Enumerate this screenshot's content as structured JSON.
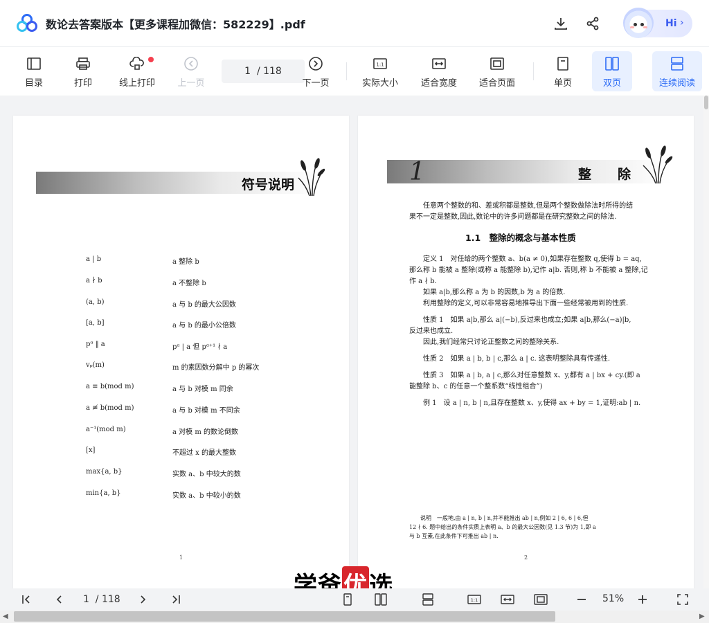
{
  "titlebar": {
    "title": "数论去答案版本【更多课程加微信：582229】.pdf",
    "hi_label": "Hi",
    "icons": [
      "download-icon",
      "share-icon"
    ]
  },
  "toolbar": {
    "items": [
      {
        "label": "目录",
        "icon": "toc-icon"
      },
      {
        "label": "打印",
        "icon": "printer-icon"
      },
      {
        "label": "线上打印",
        "icon": "cloud-print-icon"
      },
      {
        "label": "上一页",
        "icon": "prev-page-icon"
      },
      {
        "label": "下一页",
        "icon": "next-page-icon"
      },
      {
        "label": "实际大小",
        "icon": "actual-size-icon"
      },
      {
        "label": "适合宽度",
        "icon": "fit-width-icon"
      },
      {
        "label": "适合页面",
        "icon": "fit-page-icon"
      },
      {
        "label": "单页",
        "icon": "single-page-icon"
      },
      {
        "label": "双页",
        "icon": "double-page-icon"
      },
      {
        "label": "连续阅读",
        "icon": "continuous-icon"
      }
    ],
    "page_display": "1  / 118"
  },
  "page1": {
    "banner_title": "符号说明",
    "rows": [
      {
        "sym": "a | b",
        "desc": "a 整除 b"
      },
      {
        "sym": "a ∤ b",
        "desc": "a 不整除 b"
      },
      {
        "sym": "(a, b)",
        "desc": "a 与 b 的最大公因数"
      },
      {
        "sym": "[a, b]",
        "desc": "a 与 b 的最小公倍数"
      },
      {
        "sym": "pᵅ ‖ a",
        "desc": "pᵅ | a 但 pᵅ⁺¹ ∤ a"
      },
      {
        "sym": "vₚ(m)",
        "desc": "m 的素因数分解中 p 的幂次"
      },
      {
        "sym": "a ≡ b(mod m)",
        "desc": "a 与 b 对模 m 同余"
      },
      {
        "sym": "a ≢ b(mod m)",
        "desc": "a 与 b 对模 m 不同余"
      },
      {
        "sym": "a⁻¹(mod m)",
        "desc": "a 对模 m 的数论倒数"
      },
      {
        "sym": "[x]",
        "desc": "不超过 x 的最大整数"
      },
      {
        "sym": "max{a, b}",
        "desc": "实数 a、b 中较大的数"
      },
      {
        "sym": "min{a, b}",
        "desc": "实数 a、b 中较小的数"
      }
    ],
    "page_number": "1"
  },
  "page2": {
    "chapter_number": "1",
    "chapter_title": "整　　除",
    "intro": [
      "任意两个整数的和、差或积都是整数,但是两个整数做除法时所得的结",
      "果不一定是整数,因此,数论中的许多问题都是在研究整数之间的除法."
    ],
    "section_title": "1.1　整除的概念与基本性质",
    "lines": [
      {
        "text": "定义 1　对任给的两个整数 a、b(a ≠ 0),如果存在整数 q,使得 b = aq,",
        "indent": true,
        "bold_prefix": "定义 1"
      },
      {
        "text": "那么称 b 能被 a 整除(或称 a 能整除 b),记作 a|b. 否则,称 b 不能被 a 整除,记",
        "indent": false
      },
      {
        "text": "作 a ∤ b.",
        "indent": false
      },
      {
        "text": "如果 a|b,那么称 a 为 b 的因数,b 为 a 的倍数.",
        "indent": true
      },
      {
        "text": "利用整除的定义,可以非常容易地推导出下面一些经常被用到的性质.",
        "indent": true
      },
      {
        "text": "性质 1　如果 a|b,那么 a|(−b),反过来也成立;如果 a|b,那么(−a)|b,",
        "indent": true,
        "bold_prefix": "性质 1"
      },
      {
        "text": "反过来也成立.",
        "indent": false
      },
      {
        "text": "因此,我们经常只讨论正整数之间的整除关系.",
        "indent": true
      },
      {
        "text": "性质 2　如果 a | b, b | c,那么 a | c. 这表明整除具有传递性.",
        "indent": true,
        "bold_prefix": "性质 2"
      },
      {
        "text": "性质 3　如果 a | b, a | c,那么对任意整数 x、y,都有 a | bx + cy.(即 a",
        "indent": true,
        "bold_prefix": "性质 3"
      },
      {
        "text": "能整除 b、c 的任意一个整系数“线性组合”)",
        "indent": false
      },
      {
        "text": "例 1　设 a | n, b | n,且存在整数 x、y,使得 ax + by = 1,证明:ab | n.",
        "indent": true,
        "bold_prefix": "例 1"
      }
    ],
    "note": [
      "说明　一般地,由 a | n, b | n,并不能推出 ab | n,例如 2 | 6, 6 | 6,但",
      "12 ∤ 6. 题中给出的条件实质上表明 a、b 的最大公因数(见 1.3 节)为 1,即 a",
      "与 b 互素,在此条件下可推出 ab | n."
    ],
    "page_number": "2"
  },
  "watermark": {
    "pre": "学爸",
    "mark": "优",
    "post": "选"
  },
  "bottombar": {
    "page_display": "1  / 118",
    "zoom": "51%"
  }
}
